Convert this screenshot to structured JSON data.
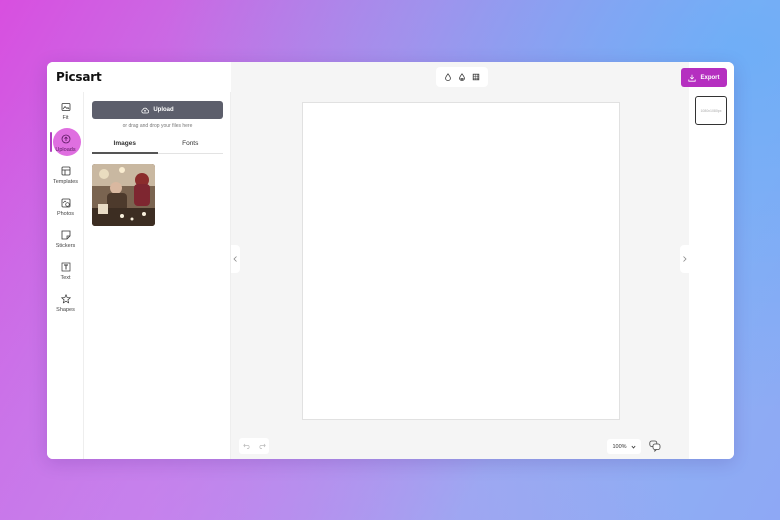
{
  "app": {
    "logo": "Picsart"
  },
  "colors": {
    "accent": "#b52fc0",
    "active_bubble": "#df6fe0",
    "upload_button": "#5d5f6c"
  },
  "sidebar": {
    "items": [
      {
        "label": "Fit",
        "icon": "image-fit-icon",
        "active": false
      },
      {
        "label": "Uploads",
        "icon": "upload-cloud-icon",
        "active": true
      },
      {
        "label": "Templates",
        "icon": "templates-icon",
        "active": false
      },
      {
        "label": "Photos",
        "icon": "photos-icon",
        "active": false
      },
      {
        "label": "Stickers",
        "icon": "sticker-icon",
        "active": false
      },
      {
        "label": "Text",
        "icon": "text-icon",
        "active": false
      },
      {
        "label": "Shapes",
        "icon": "star-icon",
        "active": false
      }
    ]
  },
  "panel": {
    "upload_label": "Upload",
    "drop_hint": "or drag and drop your files here",
    "tabs": [
      {
        "label": "Images",
        "active": true
      },
      {
        "label": "Fonts",
        "active": false
      }
    ]
  },
  "toolbar": {
    "export_label": "Export"
  },
  "canvas": {
    "zoom": "100%",
    "page_thumb_label": "1080x1080px"
  }
}
